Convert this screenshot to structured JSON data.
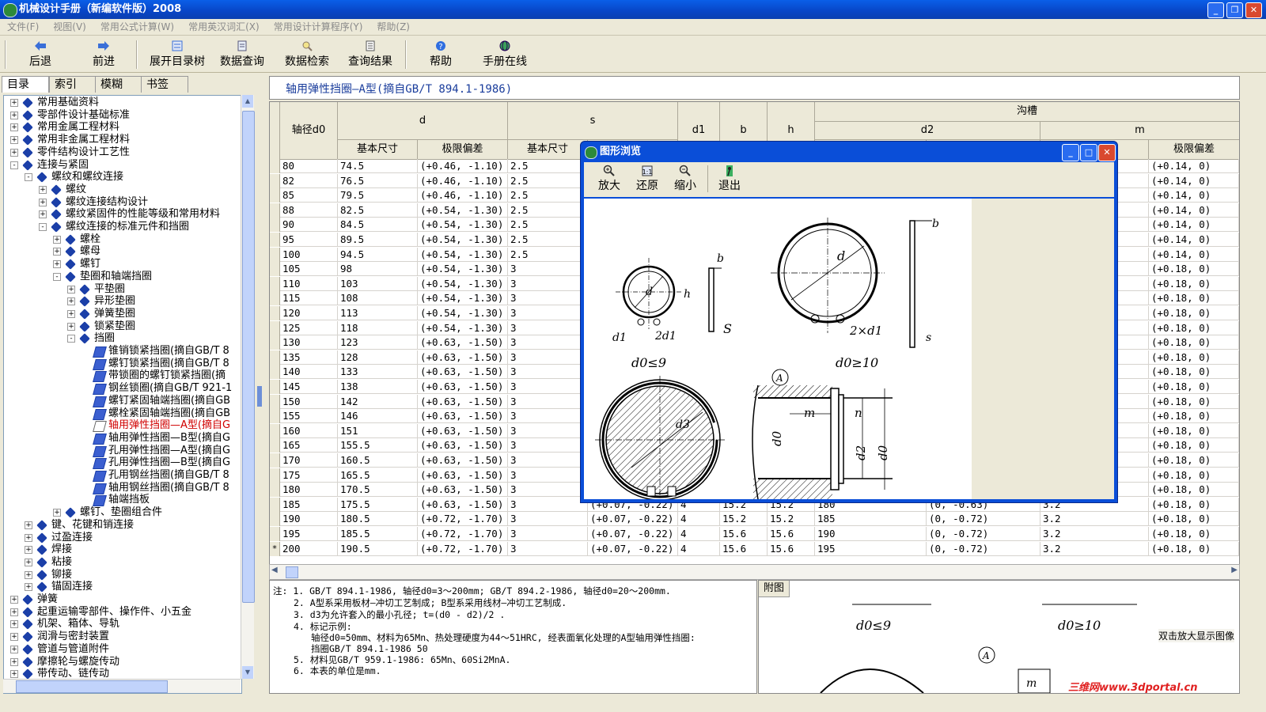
{
  "window": {
    "title": "机械设计手册（新编软件版）2008",
    "buttons": [
      "_",
      "❐",
      "✕"
    ]
  },
  "menu": [
    "文件(F)",
    "视图(V)",
    "常用公式计算(W)",
    "常用英汉词汇(X)",
    "常用设计计算程序(Y)",
    "帮助(Z)"
  ],
  "toolbar": {
    "back": "后退",
    "forward": "前进",
    "expand_tree": "展开目录树",
    "data_query": "数据查询",
    "data_search": "数据检索",
    "query_result": "查询结果",
    "help": "帮助",
    "online": "手册在线"
  },
  "tabs": [
    "目录",
    "索引",
    "模糊",
    "书签"
  ],
  "tree": [
    {
      "label": "常用基础资料",
      "level": 0,
      "exp": "+",
      "icon": "book"
    },
    {
      "label": "零部件设计基础标准",
      "level": 0,
      "exp": "+",
      "icon": "book"
    },
    {
      "label": "常用金属工程材料",
      "level": 0,
      "exp": "+",
      "icon": "book"
    },
    {
      "label": "常用非金属工程材料",
      "level": 0,
      "exp": "+",
      "icon": "book"
    },
    {
      "label": "零件结构设计工艺性",
      "level": 0,
      "exp": "+",
      "icon": "book"
    },
    {
      "label": "连接与紧固",
      "level": 0,
      "exp": "-",
      "icon": "book"
    },
    {
      "label": "螺纹和螺纹连接",
      "level": 1,
      "exp": "-",
      "icon": "book"
    },
    {
      "label": "螺纹",
      "level": 2,
      "exp": "+",
      "icon": "book"
    },
    {
      "label": "螺纹连接结构设计",
      "level": 2,
      "exp": "+",
      "icon": "book"
    },
    {
      "label": "螺纹紧固件的性能等级和常用材料",
      "level": 2,
      "exp": "+",
      "icon": "book"
    },
    {
      "label": "螺纹连接的标准元件和挡圈",
      "level": 2,
      "exp": "-",
      "icon": "book"
    },
    {
      "label": "螺栓",
      "level": 3,
      "exp": "+",
      "icon": "book"
    },
    {
      "label": "螺母",
      "level": 3,
      "exp": "+",
      "icon": "book"
    },
    {
      "label": "螺钉",
      "level": 3,
      "exp": "+",
      "icon": "book"
    },
    {
      "label": "垫圈和轴端挡圈",
      "level": 3,
      "exp": "-",
      "icon": "book"
    },
    {
      "label": "平垫圈",
      "level": 4,
      "exp": "+",
      "icon": "book"
    },
    {
      "label": "异形垫圈",
      "level": 4,
      "exp": "+",
      "icon": "book"
    },
    {
      "label": "弹簧垫圈",
      "level": 4,
      "exp": "+",
      "icon": "book"
    },
    {
      "label": "锁紧垫圈",
      "level": 4,
      "exp": "+",
      "icon": "book"
    },
    {
      "label": "挡圈",
      "level": 4,
      "exp": "-",
      "icon": "book"
    },
    {
      "label": "锥销锁紧挡圈(摘自GB/T 8",
      "level": 5,
      "exp": "",
      "icon": "doc"
    },
    {
      "label": "螺钉锁紧挡圈(摘自GB/T 8",
      "level": 5,
      "exp": "",
      "icon": "doc"
    },
    {
      "label": "带锁圈的螺钉锁紧挡圈(摘",
      "level": 5,
      "exp": "",
      "icon": "doc"
    },
    {
      "label": "钢丝锁圈(摘自GB/T 921-1",
      "level": 5,
      "exp": "",
      "icon": "doc"
    },
    {
      "label": "螺钉紧固轴端挡圈(摘自GB",
      "level": 5,
      "exp": "",
      "icon": "doc"
    },
    {
      "label": "螺栓紧固轴端挡圈(摘自GB",
      "level": 5,
      "exp": "",
      "icon": "doc"
    },
    {
      "label": "轴用弹性挡圈—A型(摘自G",
      "level": 5,
      "exp": "",
      "icon": "doc",
      "selected": true
    },
    {
      "label": "轴用弹性挡圈—B型(摘自G",
      "level": 5,
      "exp": "",
      "icon": "doc"
    },
    {
      "label": "孔用弹性挡圈—A型(摘自G",
      "level": 5,
      "exp": "",
      "icon": "doc"
    },
    {
      "label": "孔用弹性挡圈—B型(摘自G",
      "level": 5,
      "exp": "",
      "icon": "doc"
    },
    {
      "label": "孔用钢丝挡圈(摘自GB/T 8",
      "level": 5,
      "exp": "",
      "icon": "doc"
    },
    {
      "label": "轴用钢丝挡圈(摘自GB/T 8",
      "level": 5,
      "exp": "",
      "icon": "doc"
    },
    {
      "label": "轴端挡板",
      "level": 5,
      "exp": "",
      "icon": "doc"
    },
    {
      "label": "螺钉、垫圈组合件",
      "level": 3,
      "exp": "+",
      "icon": "book"
    },
    {
      "label": "键、花键和销连接",
      "level": 1,
      "exp": "+",
      "icon": "book"
    },
    {
      "label": "过盈连接",
      "level": 1,
      "exp": "+",
      "icon": "book"
    },
    {
      "label": "焊接",
      "level": 1,
      "exp": "+",
      "icon": "book"
    },
    {
      "label": "粘接",
      "level": 1,
      "exp": "+",
      "icon": "book"
    },
    {
      "label": "铆接",
      "level": 1,
      "exp": "+",
      "icon": "book"
    },
    {
      "label": "锚固连接",
      "level": 1,
      "exp": "+",
      "icon": "book"
    },
    {
      "label": "弹簧",
      "level": 0,
      "exp": "+",
      "icon": "book"
    },
    {
      "label": "起重运输零部件、操作件、小五金",
      "level": 0,
      "exp": "+",
      "icon": "book"
    },
    {
      "label": "机架、箱体、导轨",
      "level": 0,
      "exp": "+",
      "icon": "book"
    },
    {
      "label": "润滑与密封装置",
      "level": 0,
      "exp": "+",
      "icon": "book"
    },
    {
      "label": "管道与管道附件",
      "level": 0,
      "exp": "+",
      "icon": "book"
    },
    {
      "label": "摩擦轮与螺旋传动",
      "level": 0,
      "exp": "+",
      "icon": "book"
    },
    {
      "label": "带传动、链传动",
      "level": 0,
      "exp": "+",
      "icon": "book"
    }
  ],
  "content_title": "轴用弹性挡圈—A型(摘自GB/T 894.1-1986)",
  "table": {
    "headers": {
      "d0": "轴径d0",
      "d": "d",
      "s": "s",
      "d1": "d1",
      "b": "b",
      "h": "h",
      "groove": "沟槽",
      "d2": "d2",
      "m": "m",
      "basic": "基本尺寸",
      "tol": "极限偏差"
    },
    "rows": [
      [
        "80",
        "74.5",
        "(+0.46, -1.10)",
        "2.5",
        "",
        "",
        "",
        "",
        "",
        "",
        "",
        "(+0.14, 0)"
      ],
      [
        "82",
        "76.5",
        "(+0.46, -1.10)",
        "2.5",
        "",
        "",
        "",
        "",
        "",
        "",
        "",
        "(+0.14, 0)"
      ],
      [
        "85",
        "79.5",
        "(+0.46, -1.10)",
        "2.5",
        "",
        "",
        "",
        "",
        "",
        "",
        "",
        "(+0.14, 0)"
      ],
      [
        "88",
        "82.5",
        "(+0.54, -1.30)",
        "2.5",
        "",
        "",
        "",
        "",
        "",
        "",
        "",
        "(+0.14, 0)"
      ],
      [
        "90",
        "84.5",
        "(+0.54, -1.30)",
        "2.5",
        "",
        "",
        "",
        "",
        "",
        "",
        "",
        "(+0.14, 0)"
      ],
      [
        "95",
        "89.5",
        "(+0.54, -1.30)",
        "2.5",
        "",
        "",
        "",
        "",
        "",
        "",
        "",
        "(+0.14, 0)"
      ],
      [
        "100",
        "94.5",
        "(+0.54, -1.30)",
        "2.5",
        "",
        "",
        "",
        "",
        "",
        "",
        "",
        "(+0.14, 0)"
      ],
      [
        "105",
        "98",
        "(+0.54, -1.30)",
        "3",
        "",
        "",
        "",
        "",
        "",
        "",
        "",
        "(+0.18, 0)"
      ],
      [
        "110",
        "103",
        "(+0.54, -1.30)",
        "3",
        "",
        "",
        "",
        "",
        "",
        "",
        "",
        "(+0.18, 0)"
      ],
      [
        "115",
        "108",
        "(+0.54, -1.30)",
        "3",
        "",
        "",
        "",
        "",
        "",
        "",
        "",
        "(+0.18, 0)"
      ],
      [
        "120",
        "113",
        "(+0.54, -1.30)",
        "3",
        "",
        "",
        "",
        "",
        "",
        "",
        "",
        "(+0.18, 0)"
      ],
      [
        "125",
        "118",
        "(+0.54, -1.30)",
        "3",
        "",
        "",
        "",
        "",
        "",
        "",
        "",
        "(+0.18, 0)"
      ],
      [
        "130",
        "123",
        "(+0.63, -1.50)",
        "3",
        "",
        "",
        "",
        "",
        "",
        "",
        "",
        "(+0.18, 0)"
      ],
      [
        "135",
        "128",
        "(+0.63, -1.50)",
        "3",
        "",
        "",
        "",
        "",
        "",
        "",
        "",
        "(+0.18, 0)"
      ],
      [
        "140",
        "133",
        "(+0.63, -1.50)",
        "3",
        "",
        "",
        "",
        "",
        "",
        "",
        "",
        "(+0.18, 0)"
      ],
      [
        "145",
        "138",
        "(+0.63, -1.50)",
        "3",
        "",
        "",
        "",
        "",
        "",
        "",
        "",
        "(+0.18, 0)"
      ],
      [
        "150",
        "142",
        "(+0.63, -1.50)",
        "3",
        "",
        "",
        "",
        "",
        "",
        "",
        "",
        "(+0.18, 0)"
      ],
      [
        "155",
        "146",
        "(+0.63, -1.50)",
        "3",
        "",
        "",
        "",
        "",
        "",
        "",
        "",
        "(+0.18, 0)"
      ],
      [
        "160",
        "151",
        "(+0.63, -1.50)",
        "3",
        "",
        "",
        "",
        "",
        "",
        "",
        "",
        "(+0.18, 0)"
      ],
      [
        "165",
        "155.5",
        "(+0.63, -1.50)",
        "3",
        "",
        "",
        "",
        "",
        "",
        "",
        "",
        "(+0.18, 0)"
      ],
      [
        "170",
        "160.5",
        "(+0.63, -1.50)",
        "3",
        "",
        "",
        "",
        "",
        "",
        "",
        "",
        "(+0.18, 0)"
      ],
      [
        "175",
        "165.5",
        "(+0.63, -1.50)",
        "3",
        "",
        "",
        "",
        "",
        "",
        "",
        "",
        "(+0.18, 0)"
      ],
      [
        "180",
        "170.5",
        "(+0.63, -1.50)",
        "3",
        "",
        "",
        "",
        "",
        "",
        "",
        "",
        "(+0.18, 0)"
      ],
      [
        "185",
        "175.5",
        "(+0.63, -1.50)",
        "3",
        "(+0.07, -0.22)",
        "4",
        "15.2",
        "15.2",
        "180",
        "(0, -0.63)",
        "3.2",
        "(+0.18, 0)"
      ],
      [
        "190",
        "180.5",
        "(+0.72, -1.70)",
        "3",
        "(+0.07, -0.22)",
        "4",
        "15.2",
        "15.2",
        "185",
        "(0, -0.72)",
        "3.2",
        "(+0.18, 0)"
      ],
      [
        "195",
        "185.5",
        "(+0.72, -1.70)",
        "3",
        "(+0.07, -0.22)",
        "4",
        "15.6",
        "15.6",
        "190",
        "(0, -0.72)",
        "3.2",
        "(+0.18, 0)"
      ],
      [
        "200",
        "190.5",
        "(+0.72, -1.70)",
        "3",
        "(+0.07, -0.22)",
        "4",
        "15.6",
        "15.6",
        "195",
        "(0, -0.72)",
        "3.2",
        "(+0.18, 0)"
      ]
    ],
    "last_row_marker": "*"
  },
  "notes": [
    "注: 1. GB/T 894.1-1986, 轴径d0=3～200mm; GB/T 894.2-1986, 轴径d0=20～200mm.",
    "2. A型系采用板材—冲切工艺制成; B型系采用线材—冲切工艺制成.",
    "3. d3为允许套入的最小孔径; t=(d0 - d2)/2 .",
    "4. 标记示例:",
    "轴径d0=50mm、材料为65Mn、热处理硬度为44～51HRC, 经表面氧化处理的A型轴用弹性挡圈:",
    "挡圈GB/T 894.1-1986 50",
    "5. 材料见GB/T 959.1-1986: 65Mn、60Si2MnA.",
    "6. 本表的单位是mm."
  ],
  "figure_pane": {
    "tab": "附图",
    "hint": "双击放大显示图像",
    "watermark": "三维网www.3dportal.cn"
  },
  "dialog": {
    "title": "图形浏览",
    "zoom_in": "放大",
    "restore": "还原",
    "zoom_out": "缩小",
    "exit": "退出",
    "labels": {
      "d_small": "d",
      "b": "b",
      "h": "h",
      "d1": "d1",
      "two_d1": "2d1",
      "S": "S",
      "cond1": "d0≤9",
      "cond2": "d0≥10",
      "two_x_d1": "2×d1",
      "s": "s",
      "d3": "d3",
      "A": "A",
      "m": "m",
      "n": "n",
      "d0": "d0",
      "d2": "d2"
    }
  }
}
